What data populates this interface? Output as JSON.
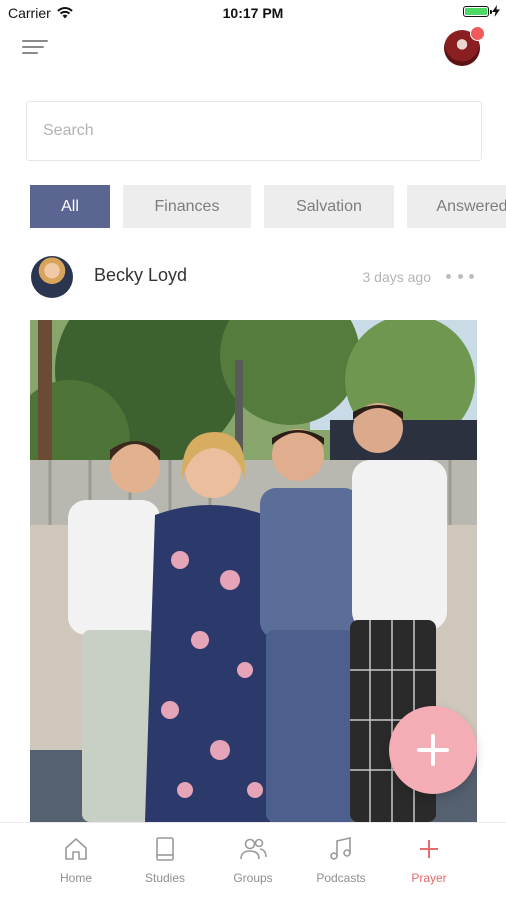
{
  "status_bar": {
    "carrier": "Carrier",
    "time": "10:17 PM"
  },
  "search": {
    "placeholder": "Search"
  },
  "filters": [
    {
      "label": "All",
      "active": true
    },
    {
      "label": "Finances",
      "active": false
    },
    {
      "label": "Salvation",
      "active": false
    },
    {
      "label": "Answered",
      "active": false
    }
  ],
  "post": {
    "author": "Becky Loyd",
    "time": "3 days ago"
  },
  "tab_bar": [
    {
      "label": "Home",
      "icon": "home-icon",
      "active": false
    },
    {
      "label": "Studies",
      "icon": "book-icon",
      "active": false
    },
    {
      "label": "Groups",
      "icon": "users-icon",
      "active": false
    },
    {
      "label": "Podcasts",
      "icon": "music-icon",
      "active": false
    },
    {
      "label": "Prayer",
      "icon": "plus-icon",
      "active": true
    }
  ],
  "colors": {
    "accent": "#5b6591",
    "fab": "#f4adb5",
    "prayer_active": "#e86a6a",
    "notification": "#f05a5a"
  }
}
